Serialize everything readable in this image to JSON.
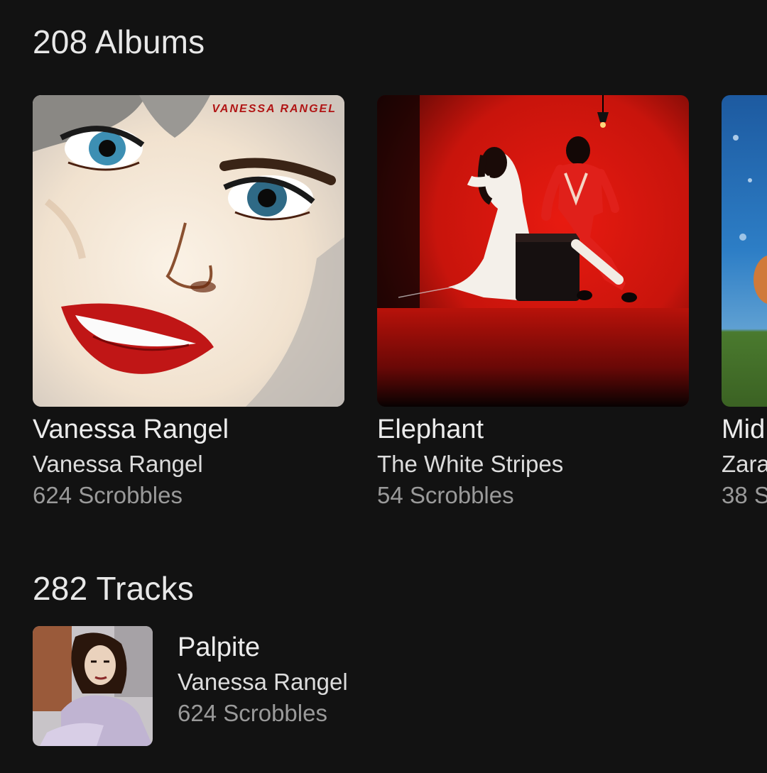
{
  "albums": {
    "title": "208 Albums",
    "items": [
      {
        "name": "Vanessa Rangel",
        "artist": "Vanessa Rangel",
        "scrobbles": "624 Scrobbles",
        "cover_text": "VANESSA RANGEL",
        "cover_icon": "album-cover-vanessa-rangel"
      },
      {
        "name": "Elephant",
        "artist": "The White Stripes",
        "scrobbles": "54 Scrobbles",
        "cover_icon": "album-cover-elephant"
      },
      {
        "name": "Mid",
        "artist": "Zara",
        "scrobbles": "38 S",
        "cover_icon": "album-cover-partial"
      }
    ]
  },
  "tracks": {
    "title": "282 Tracks",
    "items": [
      {
        "name": "Palpite",
        "artist": "Vanessa Rangel",
        "scrobbles": "624 Scrobbles",
        "cover_icon": "track-cover-palpite"
      }
    ]
  },
  "colors": {
    "background": "#121212",
    "primary_text": "#ececec",
    "secondary_text": "#dcdcdc",
    "muted_text": "#9a9a9a",
    "elephant_red": "#d9160f"
  }
}
